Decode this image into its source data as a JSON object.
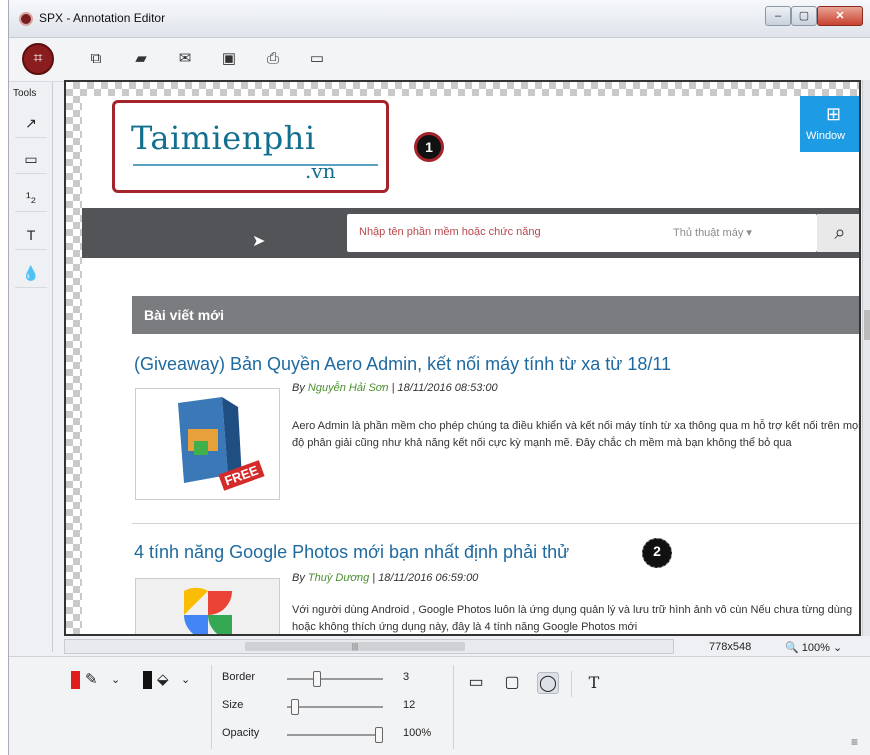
{
  "window": {
    "title": "SPX - Annotation Editor",
    "min": "–",
    "max": "▢",
    "close": "✕"
  },
  "toolbar": {
    "crop": "⌗",
    "icons": [
      "⧉",
      "▰",
      "✉",
      "▣",
      "⎙",
      "▭"
    ]
  },
  "sidebar": {
    "label": "Tools",
    "items": [
      "↗",
      "▭",
      "¹₂",
      "T",
      "💧"
    ]
  },
  "page": {
    "logo_main": "Taimienphi",
    "logo_sub": ".vn",
    "windows_tile": "Window",
    "search_placeholder": "Nhập tên phần mềm hoặc chức năng",
    "search_category": "Thủ thuật máy ▾",
    "section_title": "Bài viết mới",
    "articles": [
      {
        "title": "(Giveaway) Bản Quyền Aero Admin, kết nối máy tính từ xa từ 18/11",
        "by": "By ",
        "author": "Nguyễn Hải Sơn",
        "date": " | 18/11/2016 08:53:00",
        "body": "Aero Admin là phần mềm cho phép chúng ta điều khiển và kết nối máy tính từ xa thông qua m hỗ trợ kết nối trên mọi độ phân giải cũng như khả năng kết nối cực kỳ mạnh mẽ. Đây chắc ch mềm mà bạn không thể bỏ qua",
        "thumb_label": "FREE"
      },
      {
        "title": "4 tính năng Google Photos mới bạn nhất định phải thử",
        "by": "By ",
        "author": "Thuỳ Dương",
        "date": " | 18/11/2016 06:59:00",
        "body": "Với người dùng Android , Google Photos luôn là ứng dụng quản lý và lưu trữ hình ảnh vô cùn Nếu chưa từng dùng hoặc không thích ứng dụng này, đây là 4 tính năng Google Photos mới"
      }
    ],
    "markers": [
      "1",
      "2"
    ]
  },
  "status": {
    "dimensions": "778x548",
    "zoom": "🔍 100% ⌄",
    "hscroll_grip": "|||"
  },
  "bottom": {
    "colors": {
      "stroke": "#e01c1c",
      "fill": "#111111"
    },
    "sliders": [
      {
        "label": "Border",
        "value": "3",
        "level": 0.3
      },
      {
        "label": "Size",
        "value": "12",
        "level": 0.05
      },
      {
        "label": "Opacity",
        "value": "100%",
        "level": 1.0
      }
    ],
    "shapes": [
      "▭",
      "▢",
      "◯",
      "T"
    ]
  }
}
